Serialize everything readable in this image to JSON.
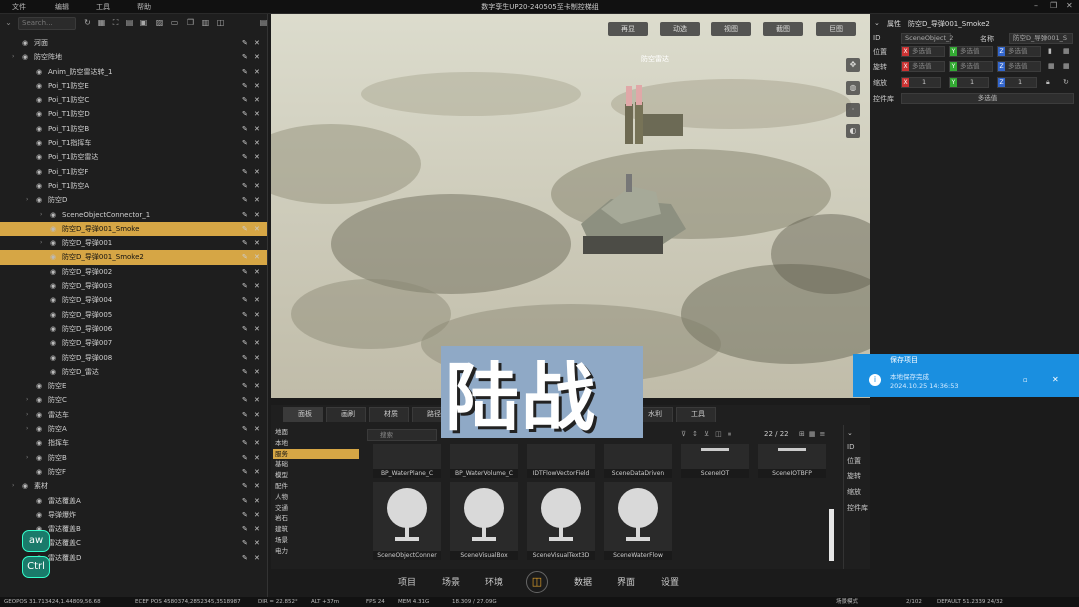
{
  "titlebar": {
    "menu": [
      "文件",
      "编辑",
      "工具",
      "帮助"
    ],
    "title": "数字孪生UP20-240505至卡制控梯组"
  },
  "outliner": {
    "search_placeholder": "Search...",
    "rows": [
      {
        "label": "河面",
        "indent": 1,
        "expand": false,
        "sel": false
      },
      {
        "label": "防空阵地",
        "indent": 1,
        "expand": true,
        "sel": false
      },
      {
        "label": "Anim_防空雷达转_1",
        "indent": 2,
        "expand": false,
        "sel": false
      },
      {
        "label": "Poi_T1防空E",
        "indent": 2,
        "expand": false,
        "sel": false
      },
      {
        "label": "Poi_T1防空C",
        "indent": 2,
        "expand": false,
        "sel": false
      },
      {
        "label": "Poi_T1防空D",
        "indent": 2,
        "expand": false,
        "sel": false
      },
      {
        "label": "Poi_T1防空B",
        "indent": 2,
        "expand": false,
        "sel": false
      },
      {
        "label": "Poi_T1指挥车",
        "indent": 2,
        "expand": false,
        "sel": false
      },
      {
        "label": "Poi_T1防空雷达",
        "indent": 2,
        "expand": false,
        "sel": false
      },
      {
        "label": "Poi_T1防空F",
        "indent": 2,
        "expand": false,
        "sel": false
      },
      {
        "label": "Poi_T1防空A",
        "indent": 2,
        "expand": false,
        "sel": false
      },
      {
        "label": "防空D",
        "indent": 2,
        "expand": true,
        "sel": false
      },
      {
        "label": "SceneObjectConnector_1",
        "indent": 3,
        "expand": true,
        "sel": false
      },
      {
        "label": "防空D_导弹001_Smoke",
        "indent": 3,
        "expand": false,
        "sel": true
      },
      {
        "label": "防空D_导弹001",
        "indent": 3,
        "expand": true,
        "sel": false
      },
      {
        "label": "防空D_导弹001_Smoke2",
        "indent": 3,
        "expand": false,
        "sel": true
      },
      {
        "label": "防空D_导弹002",
        "indent": 3,
        "expand": false,
        "sel": false
      },
      {
        "label": "防空D_导弹003",
        "indent": 3,
        "expand": false,
        "sel": false
      },
      {
        "label": "防空D_导弹004",
        "indent": 3,
        "expand": false,
        "sel": false
      },
      {
        "label": "防空D_导弹005",
        "indent": 3,
        "expand": false,
        "sel": false
      },
      {
        "label": "防空D_导弹006",
        "indent": 3,
        "expand": false,
        "sel": false
      },
      {
        "label": "防空D_导弹007",
        "indent": 3,
        "expand": false,
        "sel": false
      },
      {
        "label": "防空D_导弹008",
        "indent": 3,
        "expand": false,
        "sel": false
      },
      {
        "label": "防空D_雷达",
        "indent": 3,
        "expand": false,
        "sel": false
      },
      {
        "label": "防空E",
        "indent": 2,
        "expand": false,
        "sel": false
      },
      {
        "label": "防空C",
        "indent": 2,
        "expand": true,
        "sel": false
      },
      {
        "label": "雷达车",
        "indent": 2,
        "expand": true,
        "sel": false
      },
      {
        "label": "防空A",
        "indent": 2,
        "expand": true,
        "sel": false
      },
      {
        "label": "指挥车",
        "indent": 2,
        "expand": false,
        "sel": false
      },
      {
        "label": "防空B",
        "indent": 2,
        "expand": true,
        "sel": false
      },
      {
        "label": "防空F",
        "indent": 2,
        "expand": false,
        "sel": false
      },
      {
        "label": "素材",
        "indent": 1,
        "expand": true,
        "sel": false
      },
      {
        "label": "雷达覆盖A",
        "indent": 2,
        "expand": false,
        "sel": false
      },
      {
        "label": "导弹爆炸",
        "indent": 2,
        "expand": false,
        "sel": false
      },
      {
        "label": "雷达覆盖B",
        "indent": 2,
        "expand": false,
        "sel": false
      },
      {
        "label": "雷达覆盖C",
        "indent": 2,
        "expand": false,
        "sel": false
      },
      {
        "label": "雷达覆盖D",
        "indent": 2,
        "expand": false,
        "sel": false
      }
    ]
  },
  "viewport": {
    "buttons": [
      "再显",
      "动选",
      "视图",
      "截图",
      "巨图"
    ],
    "label": "防空雷达"
  },
  "details": {
    "header": "属性",
    "object": "防空D_导弹001_Smoke2",
    "id_label": "ID",
    "id_value": "SceneObject_2",
    "name_label": "名称",
    "name_value": "防空D_导弹001_S",
    "pos_label": "位置",
    "rot_label": "旋转",
    "scale_label": "缩放",
    "ctrl_label": "控件库",
    "multi": "多选值",
    "x": "X",
    "y": "Y",
    "z": "Z",
    "one": "1",
    "select_button": "多选值"
  },
  "notify": {
    "title": "保存项目",
    "body": "本地保存完成",
    "time": "2024.10.25 14:36:53"
  },
  "content": {
    "tabs": [
      "面板",
      "画刷",
      "材质",
      "路径",
      "水利",
      "工具"
    ],
    "folders": [
      "地面",
      "本地",
      "服务",
      "基础",
      "模型",
      "配件",
      "人物",
      "交通",
      "岩石",
      "建筑",
      "场景",
      "电力"
    ],
    "search_placeholder": "搜索",
    "count": "22 / 22",
    "top_assets": [
      "BP_WaterPlane_C",
      "BP_WaterVolume_C",
      "IDTFlowVectorField",
      "SceneDataDriven",
      "SceneIOT",
      "SceneIOTBFP"
    ],
    "assets": [
      "SceneObjectConner",
      "SceneVisualBox",
      "SceneVisualText3D",
      "SceneWaterFlow"
    ],
    "right_labels": [
      "ID",
      "位置",
      "旋转",
      "缩放",
      "控件库"
    ]
  },
  "nav": [
    "项目",
    "场景",
    "环境",
    "数据",
    "界面",
    "设置"
  ],
  "subtitle": "陆战",
  "keys": [
    "aw",
    "Ctrl"
  ],
  "status": [
    "GEOPOS 31.713424,1.44809,56.68",
    "ECEF POS 4580374,2852345,3518987",
    "DIR = 22.852°",
    "ALT +37m",
    "FPS 24",
    "MEM 4.31G",
    "18.309 / 27.09G",
    "场景模式",
    "2/102",
    "DEFAULT 51.2339 24/32"
  ]
}
